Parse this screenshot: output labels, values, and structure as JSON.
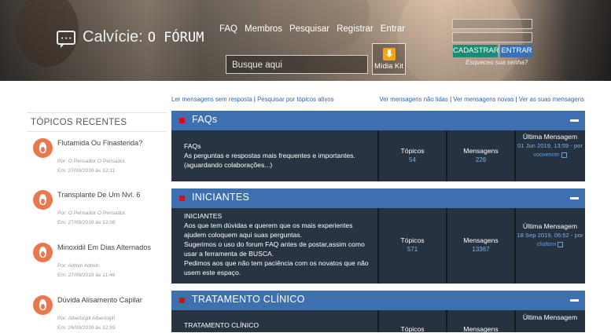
{
  "header": {
    "logo": {
      "title": "Calvície:",
      "subtitle": "O FÓRUM"
    },
    "nav": [
      "FAQ",
      "Membros",
      "Pesquisar",
      "Registrar",
      "Entrar"
    ],
    "search_placeholder": "Busque aqui",
    "midia_kit": "Mídia Kit",
    "btn_cadastrar": "CADASTRAR",
    "btn_entrar": "ENTRAR",
    "forgot": "Esqueceu sua senha?"
  },
  "quick_links": {
    "left": [
      "Ler mensagens sem resposta",
      "Pesquisar por tópicos ativos"
    ],
    "right": [
      "Ver mensagens não lidas",
      "Ver mensagens novas",
      "Ver as suas mensagens"
    ]
  },
  "sidebar": {
    "title": "TÓPICOS RECENTES",
    "topics": [
      {
        "title": "Flutamida Ou Finasterida?",
        "by": "Por: O Pensador O Pensador.",
        "date": "Em: 27/09/2019 às 12:11"
      },
      {
        "title": "Transplante De Um Nvl. 6",
        "by": "Por: O Pensador O Pensador.",
        "date": "Em: 27/09/2019 às 12:08"
      },
      {
        "title": "Minoxidil Em Dias Alternados",
        "by": "Por: Admin Admin.",
        "date": "Em: 27/09/2019 às 11:46"
      },
      {
        "title": "Dúvida Alisamento Capilar",
        "by": "Por: Albertogill Albertogill.",
        "date": "Em: 26/09/2019 às 12:59"
      }
    ]
  },
  "forums": [
    {
      "category": "FAQs",
      "title": "FAQs",
      "lines": [
        "As perguntas e respostas mais frequentes e importantes.",
        "(aguardando colaborações...)"
      ],
      "topics_label": "Tópicos",
      "topics": "54",
      "posts_label": "Mensagens",
      "posts": "226",
      "last_label": "Última Mensagem",
      "last_date": "01 Jun 2019, 13:59",
      "last_by": " - por",
      "last_user": "voovencer"
    },
    {
      "category": "INICIANTES",
      "title": "INICIANTES",
      "lines": [
        "Aos que tem dúvidas e querem que os mais experientes ajudem coloquem aqui suas perguntas.",
        "Sugerimos o uso do forum FAQ antes de postar,assim como usar a ferramenta de BUSCA.",
        "Pedimos aos que não tem paciência com os novatos que não usem este espaço."
      ],
      "topics_label": "Tópicos",
      "topics": "571",
      "posts_label": "Mensagens",
      "posts": "13367",
      "last_label": "Última Mensagem",
      "last_date": "18 Sep 2019, 06:52",
      "last_by": " - por",
      "last_user": "clialtom"
    },
    {
      "category": "TRATAMENTO CLÍNICO",
      "title": "TRATAMENTO CLÍNICO",
      "lines": [],
      "topics_label": "Tópicos",
      "topics": "",
      "posts_label": "Mensagens",
      "posts": "",
      "last_label": "Última Mensagem",
      "last_date": "",
      "last_by": "",
      "last_user": ""
    }
  ],
  "colors": {
    "forum_header": "#3e6fae",
    "forum_row": "#283441",
    "accent_red": "#c4181d",
    "link": "#2f66a8",
    "avatar": "#e9784f"
  }
}
